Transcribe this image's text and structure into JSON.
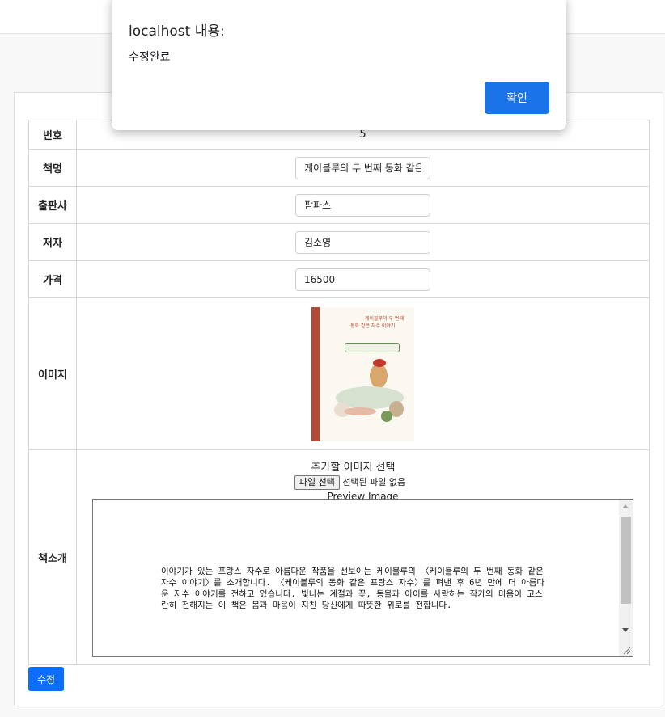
{
  "dialog": {
    "title": "localhost 내용:",
    "message": "수정완료",
    "ok_label": "확인"
  },
  "form": {
    "number": {
      "label": "번호",
      "value": "5"
    },
    "title": {
      "label": "책명",
      "value": "케이블루의 두 번째 동화 같은 자수 이야기"
    },
    "publisher": {
      "label": "출판사",
      "value": "팜파스"
    },
    "author": {
      "label": "저자",
      "value": "김소영"
    },
    "price": {
      "label": "가격",
      "value": "16500"
    },
    "image": {
      "label": "이미지",
      "cover_line1": "케이블루의 두 번째",
      "cover_line2": "동화 같은 자수 이야기"
    },
    "intro": {
      "label": "책소개",
      "add_image_caption": "추가할 이미지 선택",
      "file_button": "파일 선택",
      "file_status": "선택된 파일 없음",
      "preview_label": "Preview Image",
      "text": "이야기가 있는 프랑스 자수로 아름다운 작품을 선보이는 케이블루의 〈케이블루의 두 번째 동화 같은 자수 이야기〉를 소개합니다. 〈케이블루의 동화 같은 프랑스 자수〉를 펴낸 후 6년 만에 더 아름다운 자수 이야기를 전하고 있습니다. 빛나는 계절과 꽃, 동물과 아이를 사랑하는 작가의 마음이 고스란히 전해지는 이 책은 몸과 마음이 지친 당신에게 따뜻한 위로를 전합니다."
    }
  },
  "submit_label": "수정",
  "colors": {
    "primary": "#0d6efd",
    "dialog_button": "#1a73e8",
    "cover": "#b34a35"
  }
}
